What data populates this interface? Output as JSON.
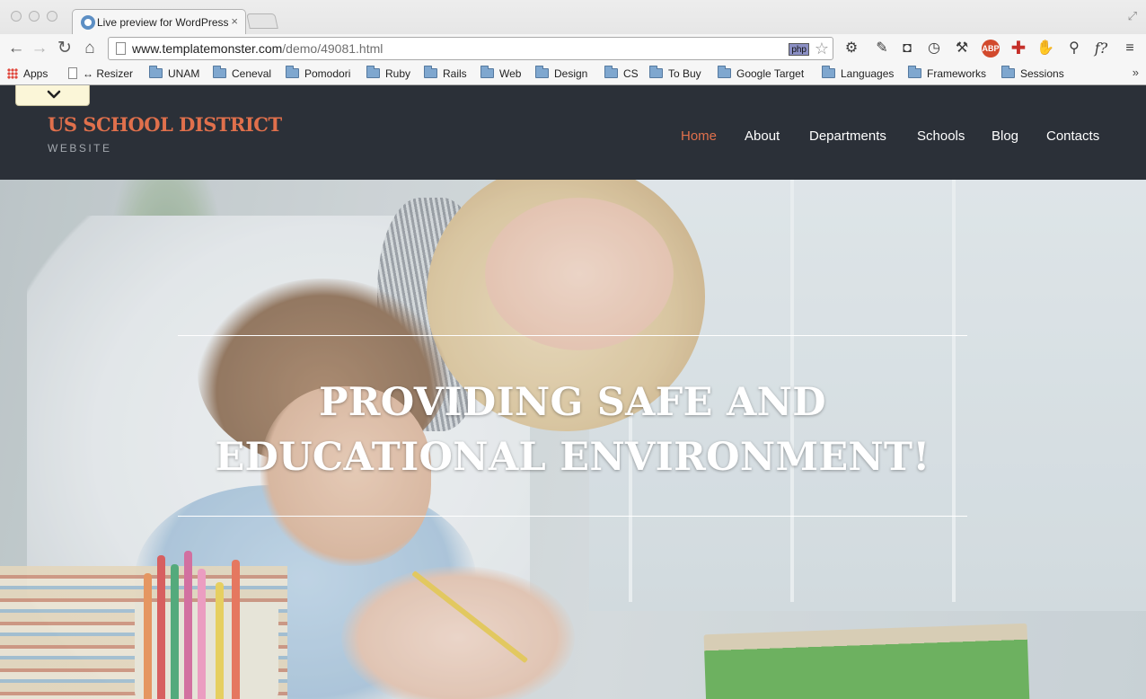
{
  "browser": {
    "tab_title": "Live preview for WordPress",
    "tab_close": "×",
    "url_domain": "www.templatemonster.com",
    "url_path": "/demo/49081.html",
    "php_badge": "php",
    "bookmarks": [
      {
        "label": "Apps",
        "icon": "apps-grid-icon"
      },
      {
        "label": "↔ Resizer",
        "icon": "page-icon"
      },
      {
        "label": "UNAM",
        "icon": "folder-icon"
      },
      {
        "label": "Ceneval",
        "icon": "folder-icon"
      },
      {
        "label": "Pomodori",
        "icon": "folder-icon"
      },
      {
        "label": "Ruby",
        "icon": "folder-icon"
      },
      {
        "label": "Rails",
        "icon": "folder-icon"
      },
      {
        "label": "Web",
        "icon": "folder-icon"
      },
      {
        "label": "Design",
        "icon": "folder-icon"
      },
      {
        "label": "CS",
        "icon": "folder-icon"
      },
      {
        "label": "To Buy",
        "icon": "folder-icon"
      },
      {
        "label": "Google Target",
        "icon": "folder-icon"
      },
      {
        "label": "Languages",
        "icon": "folder-icon"
      },
      {
        "label": "Frameworks",
        "icon": "folder-icon"
      },
      {
        "label": "Sessions",
        "icon": "folder-icon"
      }
    ],
    "bookmarks_more": "»",
    "extensions": {
      "abp": "ABP",
      "fquery": "f?"
    }
  },
  "site": {
    "logo_title": "US SCHOOL DISTRICT",
    "logo_subtitle": "WEBSITE",
    "nav": [
      "Home",
      "About",
      "Departments",
      "Schools",
      "Blog",
      "Contacts"
    ],
    "active_nav": "Home",
    "hero_headline": "PROVIDING SAFE AND EDUCATIONAL ENVIRONMENT!"
  },
  "colors": {
    "accent": "#e0704c",
    "header_bg": "#2b3038",
    "nav_text": "#ffffff"
  }
}
